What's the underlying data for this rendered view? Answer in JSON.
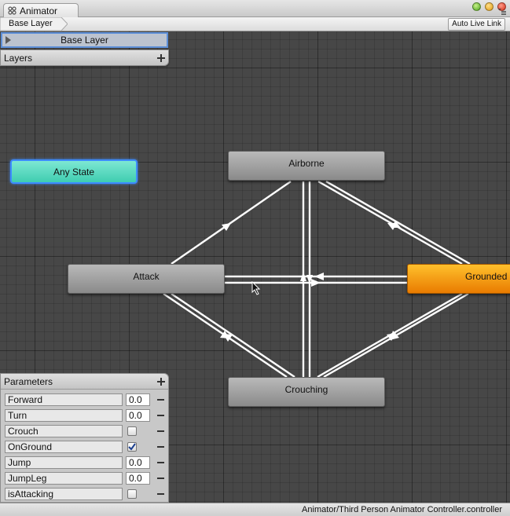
{
  "window": {
    "tab_title": "Animator",
    "icons": [
      "animator-icon",
      "minimize-button",
      "zoom-button",
      "close-button",
      "panel-menu-icon"
    ]
  },
  "toolbar": {
    "breadcrumb": "Base Layer",
    "auto_live_link": "Auto Live Link"
  },
  "layers": {
    "base_layer": "Base Layer",
    "header": "Layers"
  },
  "states": {
    "any_state": "Any State",
    "airborne": "Airborne",
    "attack": "Attack",
    "crouching": "Crouching",
    "grounded": "Grounded"
  },
  "parameters": {
    "header": "Parameters",
    "items": [
      {
        "name": "Forward",
        "type": "float",
        "value": "0.0"
      },
      {
        "name": "Turn",
        "type": "float",
        "value": "0.0"
      },
      {
        "name": "Crouch",
        "type": "bool",
        "checked": false
      },
      {
        "name": "OnGround",
        "type": "bool",
        "checked": true
      },
      {
        "name": "Jump",
        "type": "float",
        "value": "0.0"
      },
      {
        "name": "JumpLeg",
        "type": "float",
        "value": "0.0"
      },
      {
        "name": "isAttacking",
        "type": "bool",
        "checked": false
      }
    ]
  },
  "status": {
    "path": "Animator/Third Person Animator Controller.controller"
  },
  "colors": {
    "canvas": "#474747",
    "any_state": "#4fd8bc",
    "default_state": "#f59a10",
    "selection": "#3d8cff"
  }
}
